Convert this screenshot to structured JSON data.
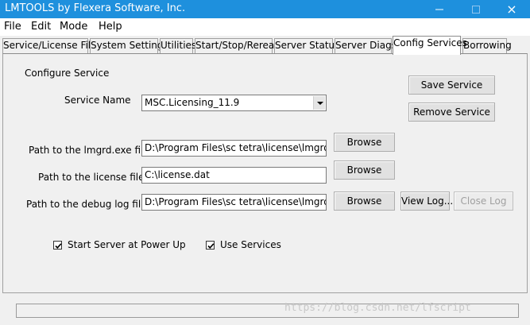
{
  "window": {
    "title": "LMTOOLS by Flexera Software, Inc.",
    "controls": {
      "minimize": "minimize-icon",
      "maximize": "maximize-icon",
      "close": "×"
    }
  },
  "menu": [
    "File",
    "Edit",
    "Mode",
    "Help"
  ],
  "tabs": [
    {
      "label": "Service/License File",
      "active": false
    },
    {
      "label": "System Settings",
      "active": false
    },
    {
      "label": "Utilities",
      "active": false
    },
    {
      "label": "Start/Stop/Reread",
      "active": false
    },
    {
      "label": "Server Status",
      "active": false
    },
    {
      "label": "Server Diags",
      "active": false
    },
    {
      "label": "Config Services",
      "active": true
    },
    {
      "label": "Borrowing",
      "active": false
    }
  ],
  "config": {
    "heading": "Configure Service",
    "service_name_label": "Service Name",
    "service_name_value": "MSC.Licensing_11.9",
    "lmgrd_label": "Path to the lmgrd.exe file",
    "lmgrd_value": "D:\\Program Files\\sc tetra\\license\\lmgrd.exe",
    "license_label": "Path to the license file",
    "license_value": "C:\\license.dat",
    "debug_label": "Path to the debug log file",
    "debug_value": "D:\\Program Files\\sc tetra\\license\\lmgrd.log",
    "save_service": "Save Service",
    "remove_service": "Remove Service",
    "browse": "Browse",
    "view_log": "View Log...",
    "close_log": "Close Log",
    "start_at_power_up": "Start Server at Power Up",
    "use_services": "Use Services"
  },
  "watermark": "https://blog.csdn.net/lfscript"
}
